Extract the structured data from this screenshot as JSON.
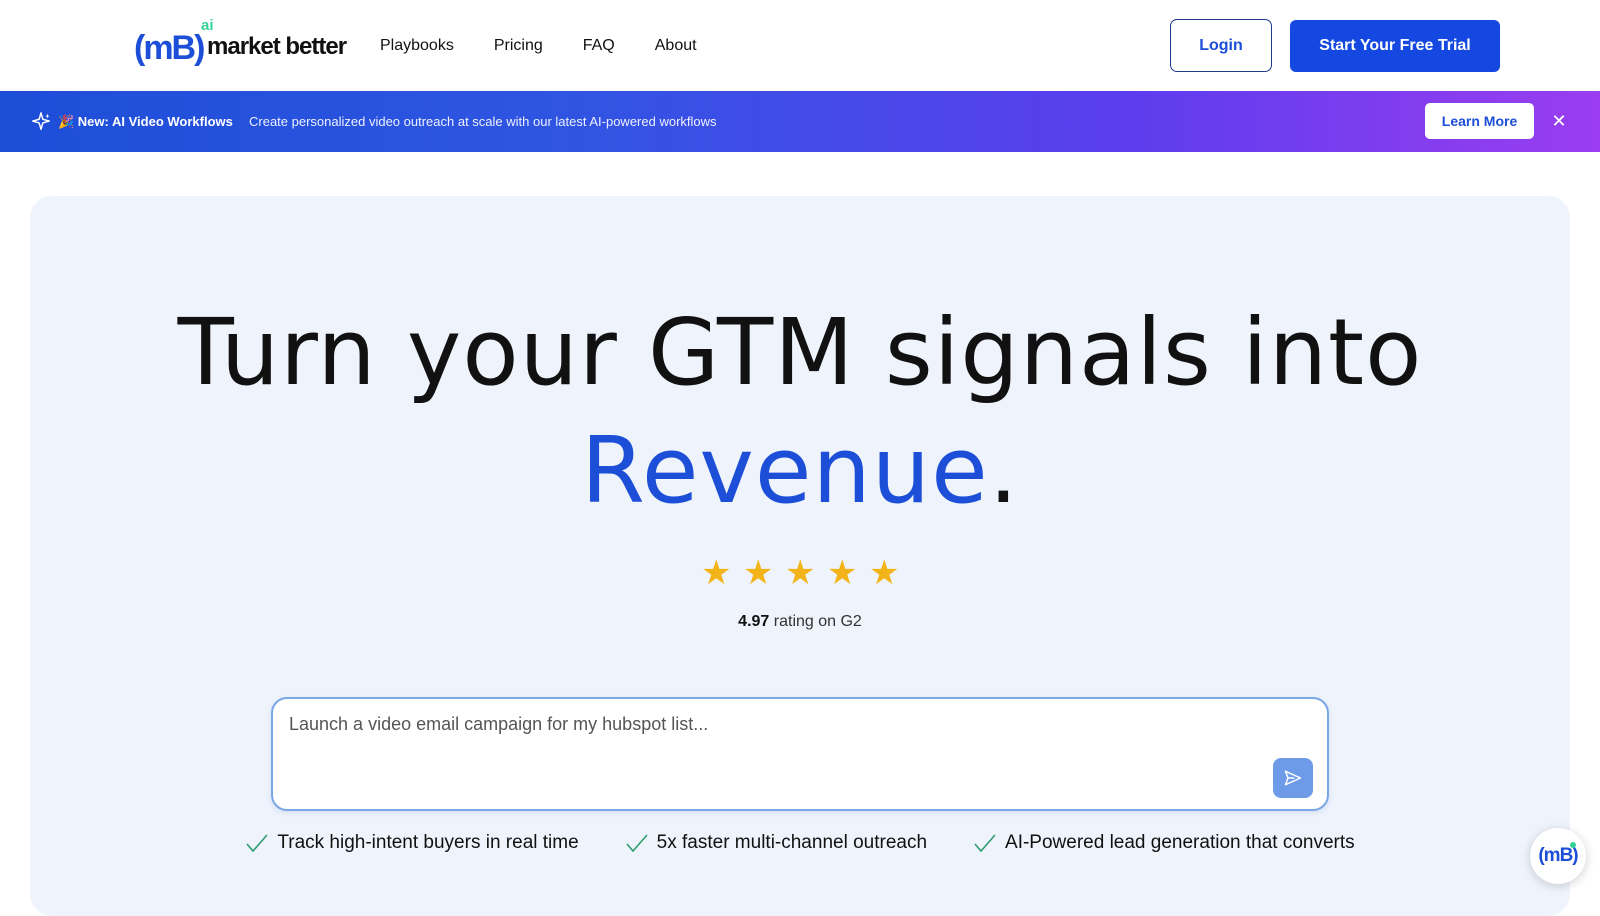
{
  "header": {
    "logo_mark": "(mB)",
    "logo_ai": "ai",
    "logo_text": "market better",
    "nav": [
      "Playbooks",
      "Pricing",
      "FAQ",
      "About"
    ],
    "login_label": "Login",
    "trial_label": "Start Your Free Trial"
  },
  "banner": {
    "icon": "sparkle-icon",
    "title": "🎉 New: AI Video Workflows",
    "text": "Create personalized video outreach at scale with our latest AI-powered workflows",
    "learn_more_label": "Learn More",
    "close_label": "✕"
  },
  "hero": {
    "headline_line1": "Turn your GTM signals into",
    "headline_accent": "Revenue",
    "headline_period": ".",
    "stars": 5,
    "rating_value": "4.97",
    "rating_text": "rating on G2",
    "prompt_placeholder": "Launch a video email campaign for my hubspot list...",
    "features": [
      "Track high-intent buyers in real time",
      "5x faster multi-channel outreach",
      "AI-Powered lead generation that converts"
    ]
  },
  "chat_widget": {
    "mark": "(mB)"
  },
  "colors": {
    "brand_blue": "#1d4ed8",
    "accent_green": "#34d399",
    "star_gold": "#f2b418",
    "hero_bg": "#eff4fc"
  }
}
